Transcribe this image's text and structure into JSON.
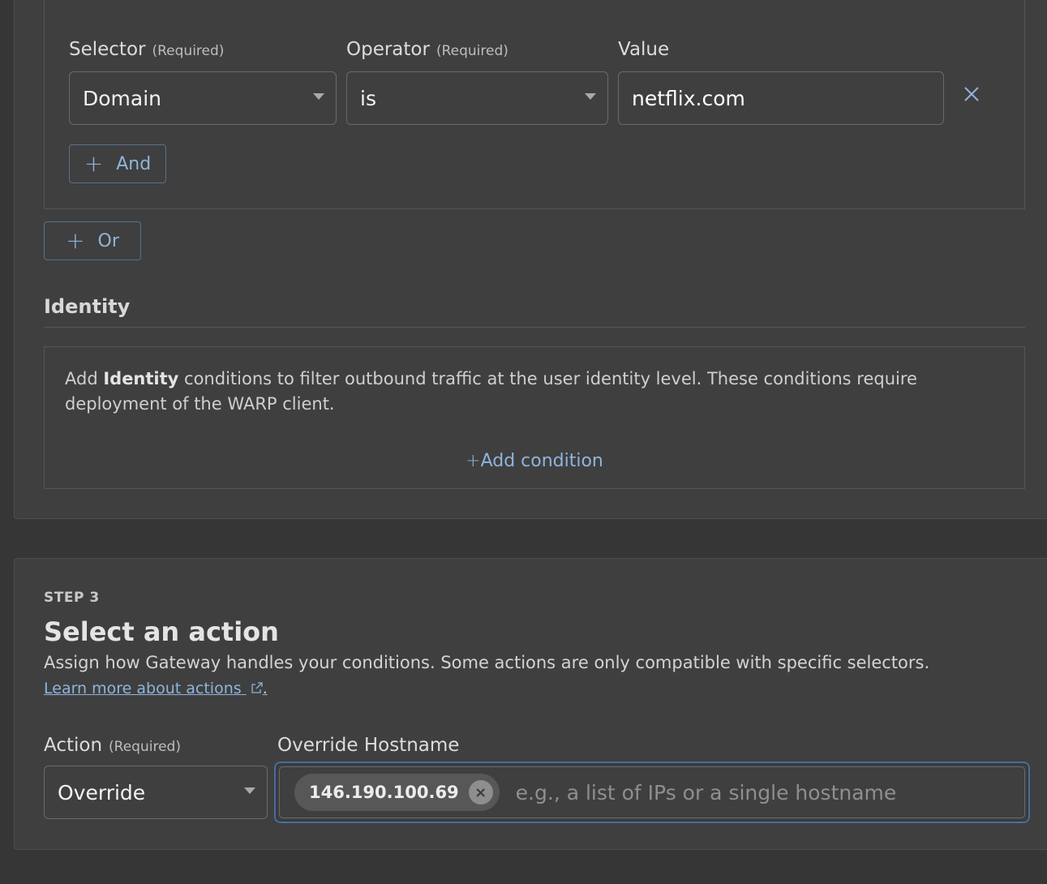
{
  "traffic": {
    "selector_label": "Selector",
    "selector_req": "(Required)",
    "operator_label": "Operator",
    "operator_req": "(Required)",
    "value_label": "Value",
    "selector_value": "Domain",
    "operator_value": "is",
    "value_value": "netflix.com",
    "and_label": "And",
    "or_label": "Or"
  },
  "identity": {
    "title": "Identity",
    "text_before": "Add ",
    "text_bold": "Identity",
    "text_after": " conditions to filter outbound traffic at the user identity level. These conditions require deployment of the WARP client.",
    "add_condition": "Add condition"
  },
  "step3": {
    "step": "STEP 3",
    "title": "Select an action",
    "description": "Assign how Gateway handles your conditions. Some actions are only compatible with specific selectors.",
    "learn_more": "Learn more about actions",
    "action_label": "Action",
    "action_req": "(Required)",
    "action_value": "Override",
    "override_label": "Override Hostname",
    "chip_value": "146.190.100.69",
    "placeholder": "e.g., a list of IPs or a single hostname"
  }
}
